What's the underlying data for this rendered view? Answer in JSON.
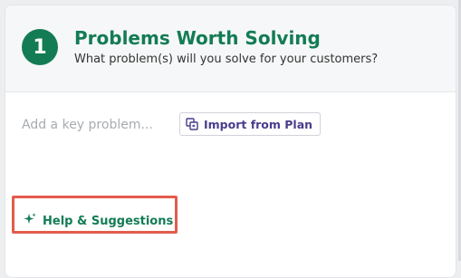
{
  "section": {
    "step_number": "1",
    "title": "Problems Worth Solving",
    "subtitle": "What problem(s) will you solve for your customers?"
  },
  "input": {
    "placeholder": "Add a key problem..."
  },
  "import_button": {
    "label": "Import from Plan",
    "icon": "import-copy-icon"
  },
  "help": {
    "label": "Help & Suggestions",
    "icon": "sparkle-icon"
  },
  "colors": {
    "brand_green": "#137c55",
    "import_text": "#4a3c8c",
    "highlight": "#e35b4c"
  }
}
